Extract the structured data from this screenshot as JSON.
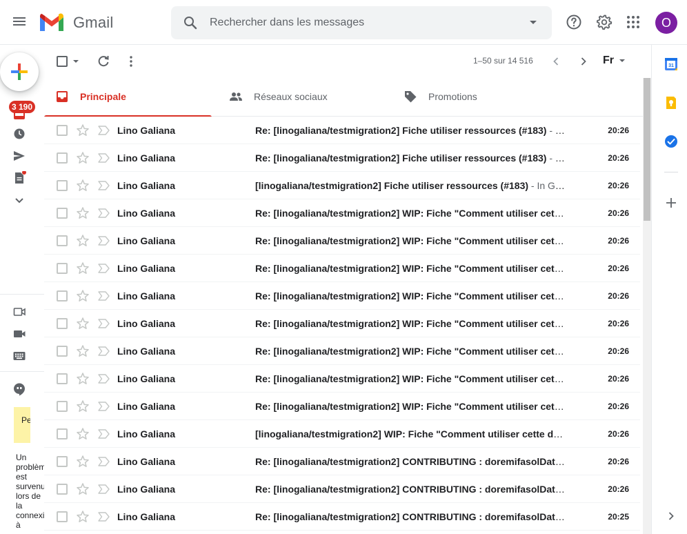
{
  "header": {
    "app_name": "Gmail",
    "search_placeholder": "Rechercher dans les messages",
    "avatar_initial": "O"
  },
  "rail": {
    "unread_count": "3 190",
    "hangout_card_text": "Petit problè",
    "hangout_message": "Un problème est survenu lors de la connexion à"
  },
  "toolbar": {
    "pager": "1–50 sur 14 516",
    "lang": "Fr"
  },
  "tabs": [
    {
      "label": "Principale",
      "icon": "inbox-icon",
      "active": true
    },
    {
      "label": "Réseaux sociaux",
      "icon": "people-icon",
      "active": false
    },
    {
      "label": "Promotions",
      "icon": "tag-icon",
      "active": false
    }
  ],
  "colors": {
    "accent_red": "#d93025",
    "avatar_purple": "#7b1fa2",
    "badge_red": "#d93025"
  },
  "emails": [
    {
      "sender": "Lino Galiana",
      "subject": "Re: [linogaliana/testmigration2] Fiche utiliser ressources (#183)",
      "snippet": " - In…",
      "time": "20:26"
    },
    {
      "sender": "Lino Galiana",
      "subject": "Re: [linogaliana/testmigration2] Fiche utiliser ressources (#183)",
      "snippet": " - In…",
      "time": "20:26"
    },
    {
      "sender": "Lino Galiana",
      "subject": "[linogaliana/testmigration2] Fiche utiliser ressources (#183)",
      "snippet": " - In Git…",
      "time": "20:26"
    },
    {
      "sender": "Lino Galiana",
      "subject": "Re: [linogaliana/testmigration2] WIP: Fiche \"Comment utiliser cette …",
      "snippet": "",
      "time": "20:26"
    },
    {
      "sender": "Lino Galiana",
      "subject": "Re: [linogaliana/testmigration2] WIP: Fiche \"Comment utiliser cette …",
      "snippet": "",
      "time": "20:26"
    },
    {
      "sender": "Lino Galiana",
      "subject": "Re: [linogaliana/testmigration2] WIP: Fiche \"Comment utiliser cette …",
      "snippet": "",
      "time": "20:26"
    },
    {
      "sender": "Lino Galiana",
      "subject": "Re: [linogaliana/testmigration2] WIP: Fiche \"Comment utiliser cette …",
      "snippet": "",
      "time": "20:26"
    },
    {
      "sender": "Lino Galiana",
      "subject": "Re: [linogaliana/testmigration2] WIP: Fiche \"Comment utiliser cette …",
      "snippet": "",
      "time": "20:26"
    },
    {
      "sender": "Lino Galiana",
      "subject": "Re: [linogaliana/testmigration2] WIP: Fiche \"Comment utiliser cette …",
      "snippet": "",
      "time": "20:26"
    },
    {
      "sender": "Lino Galiana",
      "subject": "Re: [linogaliana/testmigration2] WIP: Fiche \"Comment utiliser cette …",
      "snippet": "",
      "time": "20:26"
    },
    {
      "sender": "Lino Galiana",
      "subject": "Re: [linogaliana/testmigration2] WIP: Fiche \"Comment utiliser cette …",
      "snippet": "",
      "time": "20:26"
    },
    {
      "sender": "Lino Galiana",
      "subject": "[linogaliana/testmigration2] WIP: Fiche \"Comment utiliser cette doc…",
      "snippet": "",
      "time": "20:26"
    },
    {
      "sender": "Lino Galiana",
      "subject": "Re: [linogaliana/testmigration2] CONTRIBUTING : doremifasolData …",
      "snippet": "",
      "time": "20:26"
    },
    {
      "sender": "Lino Galiana",
      "subject": "Re: [linogaliana/testmigration2] CONTRIBUTING : doremifasolData …",
      "snippet": "",
      "time": "20:26"
    },
    {
      "sender": "Lino Galiana",
      "subject": "Re: [linogaliana/testmigration2] CONTRIBUTING : doremifasolData …",
      "snippet": "",
      "time": "20:25"
    }
  ]
}
